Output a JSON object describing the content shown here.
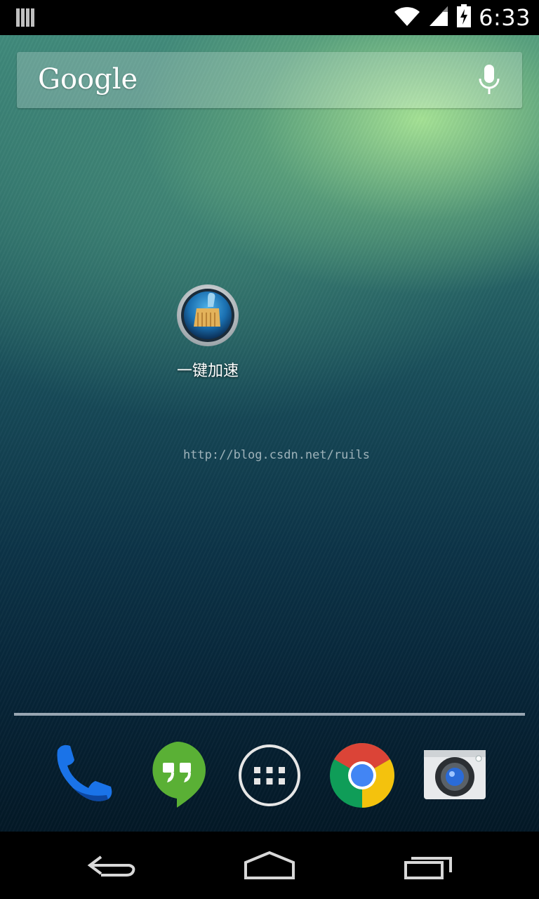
{
  "status_bar": {
    "notification_icon": "notification-bars-icon",
    "wifi_icon": "wifi-icon",
    "signal_icon": "cell-signal-icon",
    "battery_icon": "battery-charging-icon",
    "time": "6:33"
  },
  "search_widget": {
    "logo_text": "Google",
    "mic_icon": "microphone-icon"
  },
  "home_screen": {
    "app": {
      "label": "一键加速",
      "icon": "broom-cleaner-icon"
    },
    "watermark": "http://blog.csdn.net/ruils"
  },
  "dock": {
    "items": [
      {
        "name": "Phone",
        "icon": "phone-icon"
      },
      {
        "name": "Hangouts",
        "icon": "hangouts-icon"
      },
      {
        "name": "Apps",
        "icon": "app-drawer-icon"
      },
      {
        "name": "Chrome",
        "icon": "chrome-icon"
      },
      {
        "name": "Camera",
        "icon": "camera-icon"
      }
    ]
  },
  "nav_bar": {
    "back_icon": "back-icon",
    "home_icon": "home-icon",
    "recents_icon": "recent-apps-icon"
  },
  "colors": {
    "accent_wallpaper_green": "#a6dc93",
    "wallpaper_dark": "#072538",
    "chrome_red": "#db4437",
    "chrome_yellow": "#f4c20d",
    "chrome_green": "#0f9d58",
    "chrome_blue": "#4285f4"
  }
}
